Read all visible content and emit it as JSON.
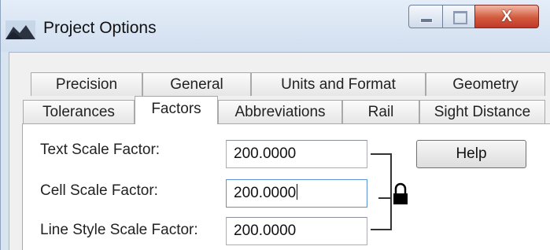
{
  "window": {
    "title": "Project Options",
    "controls": {
      "minimize_icon": "minimize-icon",
      "maximize_icon": "maximize-icon",
      "close_glyph": "X"
    }
  },
  "tabs": {
    "row_top": [
      "Precision",
      "General",
      "Units and Format",
      "Geometry"
    ],
    "row_bottom": [
      "Tolerances",
      "Factors",
      "Abbreviations",
      "Rail",
      "Sight Distance"
    ],
    "selected": "Factors"
  },
  "factors": {
    "text_scale": {
      "label": "Text Scale Factor:",
      "value": "200.0000"
    },
    "cell_scale": {
      "label": "Cell Scale Factor:",
      "value": "200.0000"
    },
    "line_style_scale": {
      "label": "Line Style Scale Factor:",
      "value": "200.0000"
    }
  },
  "help_button": {
    "label": "Help"
  },
  "lock": {
    "icon": "padlock-icon",
    "state": "locked"
  }
}
